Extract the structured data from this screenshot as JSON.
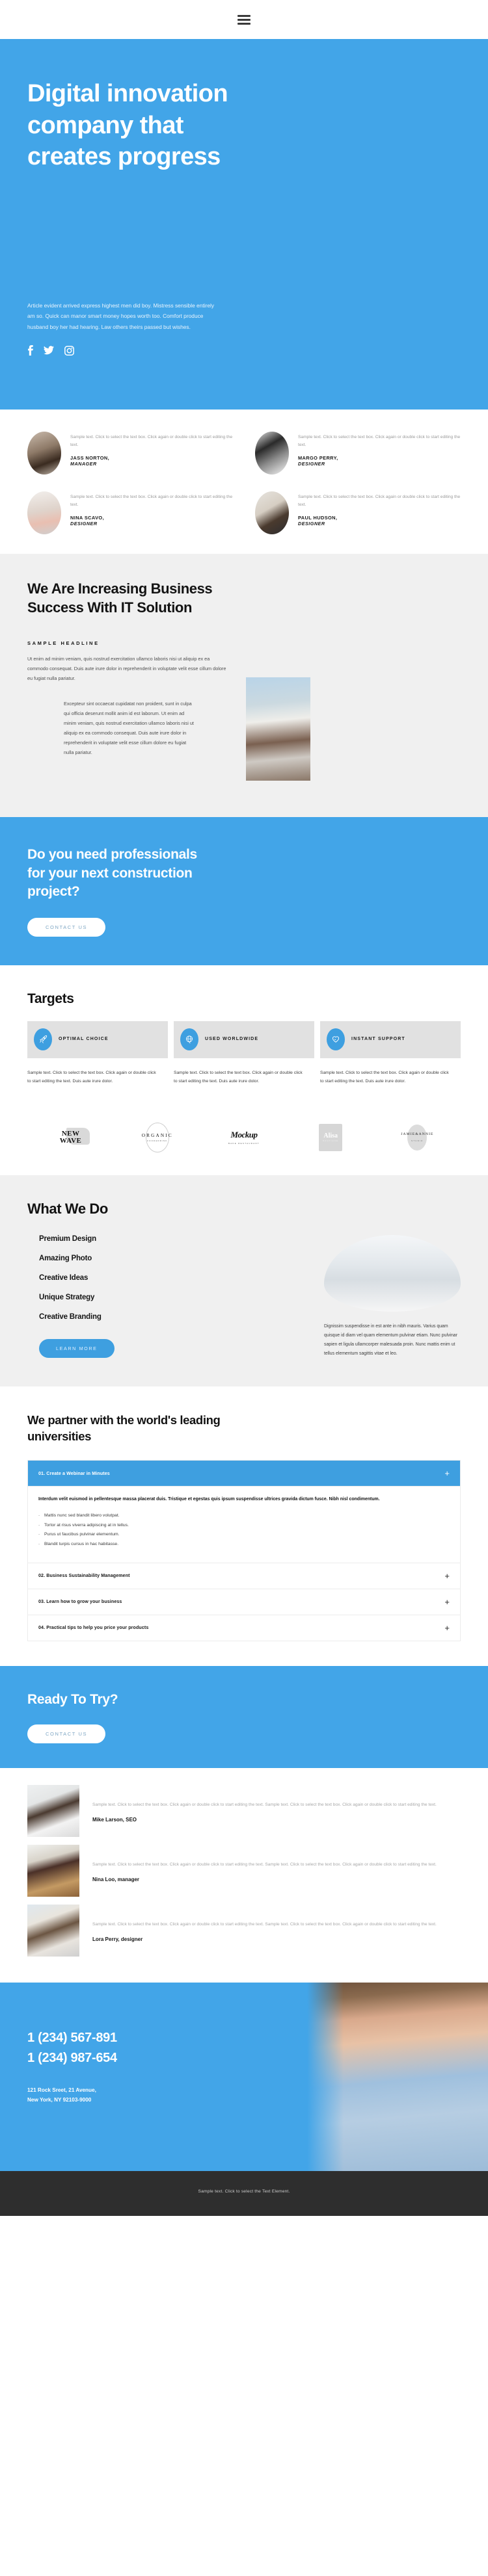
{
  "nav": {
    "menu_icon": "hamburger-icon"
  },
  "hero": {
    "title_line1": "Digital innovation",
    "title_line2": "company that",
    "title_line3": "creates progress",
    "paragraph": "Article evident arrived express highest men did boy. Mistress sensible entirely am so. Quick can manor smart money hopes worth too. Comfort produce husband boy her had hearing. Law others theirs passed but wishes.",
    "social": [
      {
        "name": "facebook-icon"
      },
      {
        "name": "twitter-icon"
      },
      {
        "name": "instagram-icon"
      }
    ],
    "bg_color": "#42a5e8"
  },
  "team": {
    "members": [
      {
        "text": "Sample text. Click to select the text box. Click again or double click to start editing the text.",
        "name": "JASS NORTON,",
        "role": "MANAGER"
      },
      {
        "text": "Sample text. Click to select the text box. Click again or double click to start editing the text.",
        "name": "MARGO PERRY,",
        "role": "DESIGNER"
      },
      {
        "text": "Sample text. Click to select the text box. Click again or double click to start editing the text.",
        "name": "NINA SCAVO,",
        "role": "DESIGNER"
      },
      {
        "text": "Sample text. Click to select the text box. Click again or double click to start editing the text.",
        "name": "PAUL HUDSON,",
        "role": "DESIGNER"
      }
    ]
  },
  "it_solution": {
    "title_line1": "We Are Increasing Business",
    "title_line2": "Success With IT Solution",
    "eyebrow": "SAMPLE HEADLINE",
    "body": "Ut enim ad minim veniam, quis nostrud exercitation ullamco laboris nisi ut aliquip ex ea commodo consequat. Duis aute irure dolor in reprehenderit in voluptate velit esse cillum dolore eu fugiat nulla pariatur.",
    "quote": "Excepteur sint occaecat cupidatat non proident, sunt in culpa qui officia deserunt mollit anim id est laborum. Ut enim ad minim veniam, quis nostrud exercitation ullamco laboris nisi ut aliquip ex ea commodo consequat. Duis aute irure dolor in reprehenderit in voluptate velit esse cillum dolore eu fugiat nulla pariatur."
  },
  "cta_construction": {
    "title_line1": "Do you need professionals",
    "title_line2": "for your next construction",
    "title_line3": "project?",
    "button": "CONTACT US"
  },
  "targets": {
    "title": "Targets",
    "cards": [
      {
        "icon": "rocket-icon",
        "label": "OPTIMAL CHOICE",
        "text": "Sample text. Click to select the text box. Click again or double click to start editing the text. Duis aute irure dolor."
      },
      {
        "icon": "globe-pin-icon",
        "label": "USED WORLDWIDE",
        "text": "Sample text. Click to select the text box. Click again or double click to start editing the text. Duis aute irure dolor."
      },
      {
        "icon": "heart-handshake-icon",
        "label": "INSTANT SUPPORT",
        "text": "Sample text. Click to select the text box. Click again or double click to start editing the text. Duis aute irure dolor."
      }
    ]
  },
  "logos": [
    {
      "name": "new-wave-logo",
      "line1": "NEW",
      "line2": "WAVE"
    },
    {
      "name": "organic-logo",
      "line1": "ORGANIC",
      "line2": "FOOD&DRINK"
    },
    {
      "name": "mockup-logo",
      "line1": "Mockup",
      "line2": "BAKE RESTAURANT"
    },
    {
      "name": "alisa-logo",
      "line1": "Alisa",
      "line2": "BOUTIQUE"
    },
    {
      "name": "jamie-annie-logo",
      "line1": "JAMIE&ANNIE",
      "line2": "STUDIO"
    }
  ],
  "what_we_do": {
    "title": "What We Do",
    "items": [
      "Premium Design",
      "Amazing Photo",
      "Creative Ideas",
      "Unique Strategy",
      "Creative Branding"
    ],
    "button": "LEARN MORE",
    "text": "Dignissim suspendisse in est ante in nibh mauris. Varius quam quisque id diam vel quam elementum pulvinar etiam. Nunc pulvinar sapien et ligula ullamcorper malesuada proin. Nunc mattis enim ut tellus elementum sagittis vitae et leo."
  },
  "universities": {
    "title_line1": "We partner with the world's leading",
    "title_line2": "universities",
    "accordion": [
      {
        "title": "01. Create a Webinar in Minutes",
        "open": true,
        "lead": "Interdum velit euismod in pellentesque massa placerat duis. Tristique et egestas quis ipsum suspendisse ultrices gravida dictum fusce. Nibh nisl condimentum.",
        "bullets": [
          "Mattis nunc sed blandit libero volutpat.",
          "Tortor at risus viverra adipiscing at in tellus.",
          "Purus ut faucibus pulvinar elementum.",
          "Blandit turpis cursus in hac habitasse."
        ]
      },
      {
        "title": "02. Business Sustainability Management",
        "open": false
      },
      {
        "title": "03. Learn how to grow your business",
        "open": false
      },
      {
        "title": "04. Practical tips to help you price your products",
        "open": false
      }
    ],
    "plus_icon": "plus-icon"
  },
  "ready": {
    "title": "Ready To Try?",
    "button": "CONTACT US"
  },
  "testimonials": [
    {
      "text": "Sample text. Click to select the text box. Click again or double click to start editing the text. Sample text. Click to select the text box. Click again or double click to start editing the text.",
      "name": "Mike Larson, SEO"
    },
    {
      "text": "Sample text. Click to select the text box. Click again or double click to start editing the text. Sample text. Click to select the text box. Click again or double click to start editing the text.",
      "name": "Nina Loo, manager"
    },
    {
      "text": "Sample text. Click to select the text box. Click again or double click to start editing the text. Sample text. Click to select the text box. Click again or double click to start editing the text.",
      "name": "Lora Perry, designer"
    }
  ],
  "footer": {
    "phone1": "1 (234) 567-891",
    "phone2": "1 (234) 987-654",
    "address_line1": "121 Rock Sreet, 21 Avenue,",
    "address_line2": "New York, NY 92103-9000",
    "bottom_text": "Sample text. Click to select the Text Element."
  }
}
